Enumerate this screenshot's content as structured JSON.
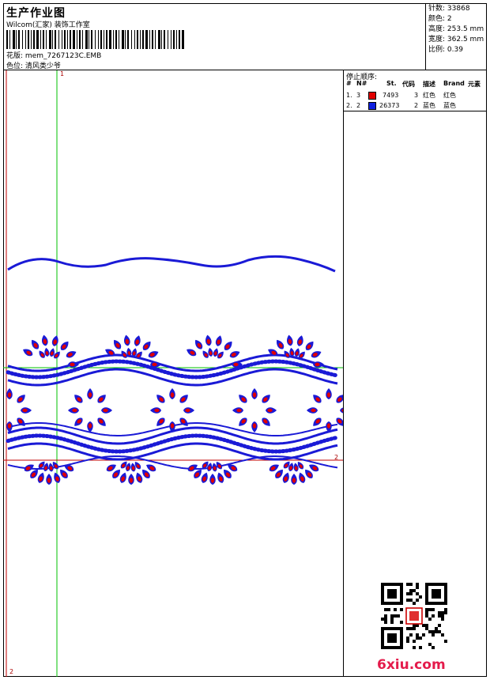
{
  "header": {
    "title": "生产作业图",
    "studio": "Wilcom(汇家) 装饰工作室",
    "design_label": "花版:",
    "design_file": "mem_7267123C.EMB",
    "colorway_label": "色位:",
    "colorway": "清风类少爷"
  },
  "stats": [
    {
      "label": "针数:",
      "value": "33868"
    },
    {
      "label": "颜色:",
      "value": "2"
    },
    {
      "label": "高度:",
      "value": "253.5 mm"
    },
    {
      "label": "宽度:",
      "value": "362.5 mm"
    },
    {
      "label": "比例:",
      "value": "0.39"
    }
  ],
  "stop_sequence": {
    "title": "停止顺序:",
    "columns": [
      "#",
      "N#",
      "St.",
      "代码",
      "描述",
      "Brand",
      "元素"
    ],
    "rows": [
      {
        "idx": "1.",
        "n": "3",
        "color": "#e00000",
        "stitches": "7493",
        "code": "3",
        "desc": "红色",
        "brand": "红色"
      },
      {
        "idx": "2.",
        "n": "2",
        "color": "#1020e0",
        "stitches": "26373",
        "code": "2",
        "desc": "蓝色",
        "brand": "蓝色"
      }
    ]
  },
  "canvas": {
    "axis_top": "1",
    "axis_right": "2",
    "axis_bottom": "2",
    "thread_blue": "#1a1ad6",
    "thread_red": "#e00000",
    "guide_green": "#00c000",
    "guide_red": "#c00000"
  },
  "watermark": "6xiu.com"
}
